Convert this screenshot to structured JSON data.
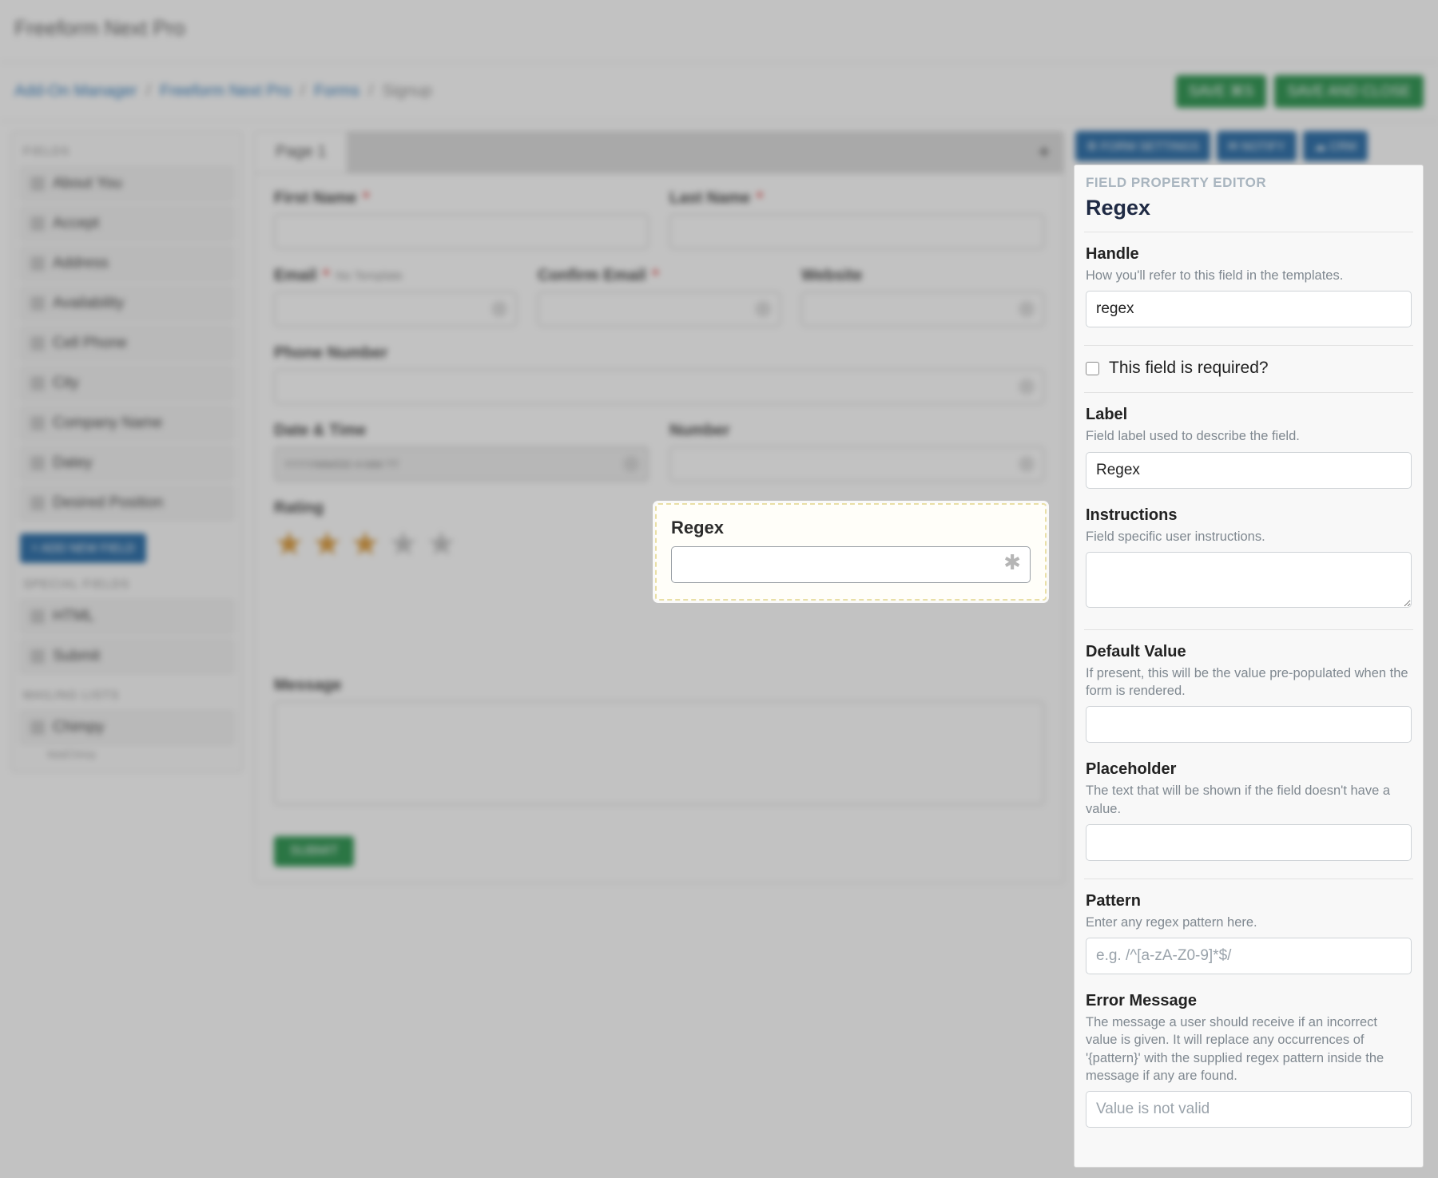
{
  "app_title": "Freeform Next Pro",
  "breadcrumbs": {
    "items": [
      "Add-On Manager",
      "Freeform Next Pro",
      "Forms"
    ],
    "current": "Signup"
  },
  "top_actions": {
    "save": "SAVE ⌘S",
    "save_close": "SAVE AND CLOSE"
  },
  "left": {
    "heading_fields": "FIELDS",
    "fields": [
      {
        "label": "About You"
      },
      {
        "label": "Accept"
      },
      {
        "label": "Address"
      },
      {
        "label": "Availability"
      },
      {
        "label": "Cell Phone"
      },
      {
        "label": "City"
      },
      {
        "label": "Company Name"
      },
      {
        "label": "Datey"
      },
      {
        "label": "Desired Position"
      }
    ],
    "add_new": "+ ADD NEW FIELD",
    "heading_special": "SPECIAL FIELDS",
    "special": [
      {
        "label": "HTML"
      },
      {
        "label": "Submit"
      }
    ],
    "heading_mailing": "MAILING LISTS",
    "mailing": [
      {
        "label": "Chimpy",
        "sub": "MailChimp"
      }
    ]
  },
  "canvas": {
    "tab": "Page 1",
    "first_name": "First Name",
    "last_name": "Last Name",
    "email": "Email",
    "email_sub": "No Template",
    "confirm_email": "Confirm Email",
    "website": "Website",
    "phone": "Phone Number",
    "datetime": "Date & Time",
    "datetime_ph": "YYYY/MM/DD H:MM TT",
    "number": "Number",
    "rating": "Rating",
    "message": "Message",
    "submit": "SUBMIT"
  },
  "right_buttons": {
    "settings": "⚙ FORM SETTINGS",
    "notify": "✉ NOTIFY",
    "crm": "☁ CRM"
  },
  "regex_card": {
    "label": "Regex"
  },
  "editor": {
    "kicker": "FIELD PROPERTY EDITOR",
    "title": "Regex",
    "handle": {
      "label": "Handle",
      "help": "How you'll refer to this field in the templates.",
      "value": "regex"
    },
    "required_label": "This field is required?",
    "label": {
      "label": "Label",
      "help": "Field label used to describe the field.",
      "value": "Regex"
    },
    "instructions": {
      "label": "Instructions",
      "help": "Field specific user instructions.",
      "value": ""
    },
    "default_value": {
      "label": "Default Value",
      "help": "If present, this will be the value pre-populated when the form is rendered.",
      "value": ""
    },
    "placeholder": {
      "label": "Placeholder",
      "help": "The text that will be shown if the field doesn't have a value.",
      "value": ""
    },
    "pattern": {
      "label": "Pattern",
      "help": "Enter any regex pattern here.",
      "placeholder": "e.g. /^[a-zA-Z0-9]*$/",
      "value": ""
    },
    "error_message": {
      "label": "Error Message",
      "help": "The message a user should receive if an incorrect value is given. It will replace any occurrences of '{pattern}' with the supplied regex pattern inside the message if any are found.",
      "placeholder": "Value is not valid",
      "value": ""
    }
  }
}
